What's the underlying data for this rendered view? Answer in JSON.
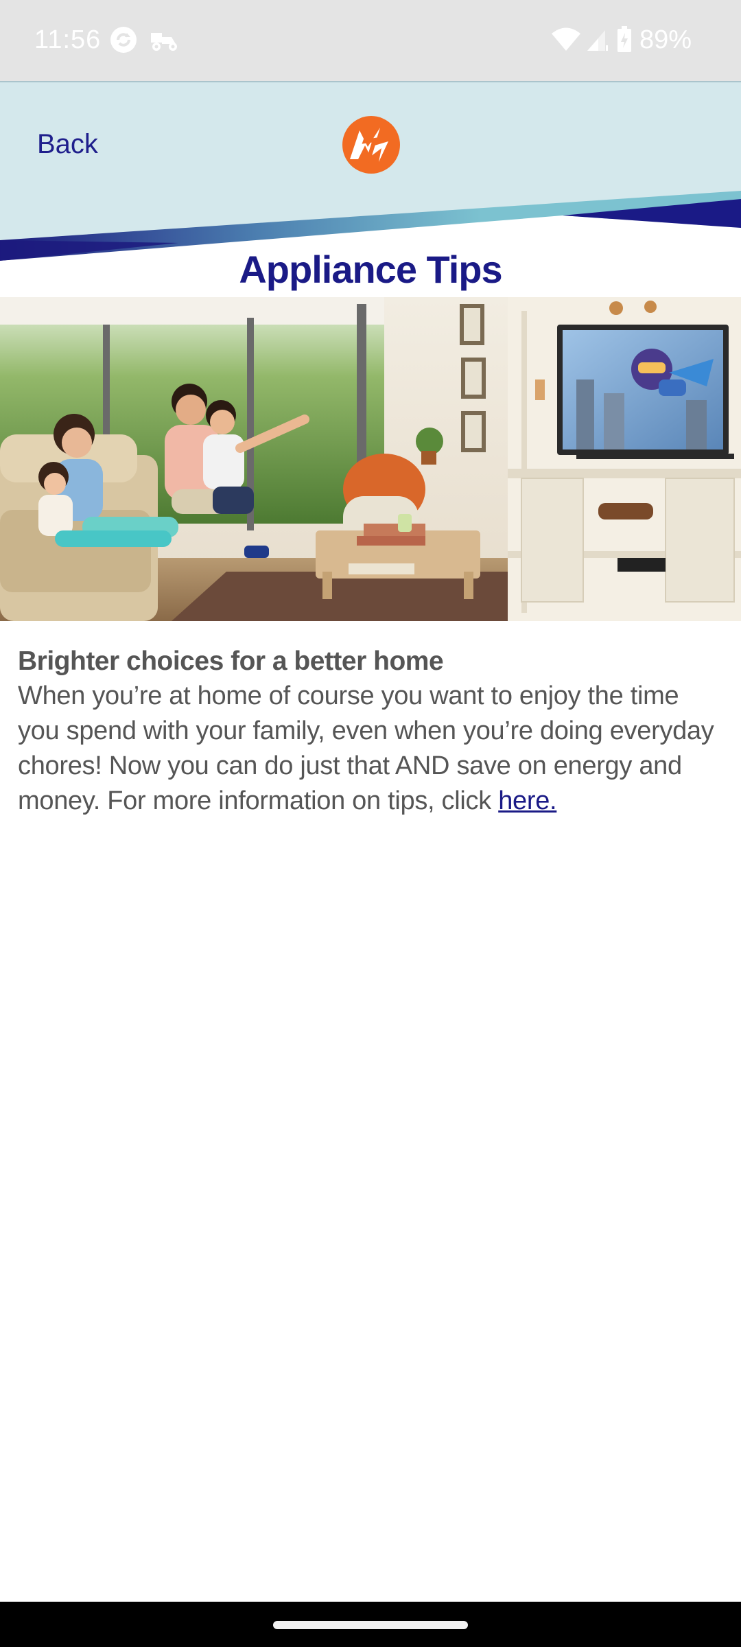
{
  "status_bar": {
    "time": "11:56",
    "battery": "89%",
    "icons": [
      "sync-icon",
      "scooter-icon",
      "wifi-icon",
      "signal-icon",
      "battery-icon"
    ]
  },
  "header": {
    "back_label": "Back",
    "logo": "meralco-logo"
  },
  "page": {
    "title": "Appliance Tips"
  },
  "hero": {
    "image": "family-watching-tv-living-room"
  },
  "content": {
    "heading": "Brighter choices for a better home",
    "body": "When you’re at home of course you want to enjoy the time you spend with your family, even when you’re doing everyday chores! Now you can do just that AND save on energy and money. For more information on tips, click ",
    "link_label": "here."
  },
  "colors": {
    "status_bar_bg": "#e4e4e4",
    "header_bg": "#d4e8ec",
    "brand_navy": "#1a1a86",
    "brand_orange": "#f26b22",
    "body_text": "#555555"
  }
}
